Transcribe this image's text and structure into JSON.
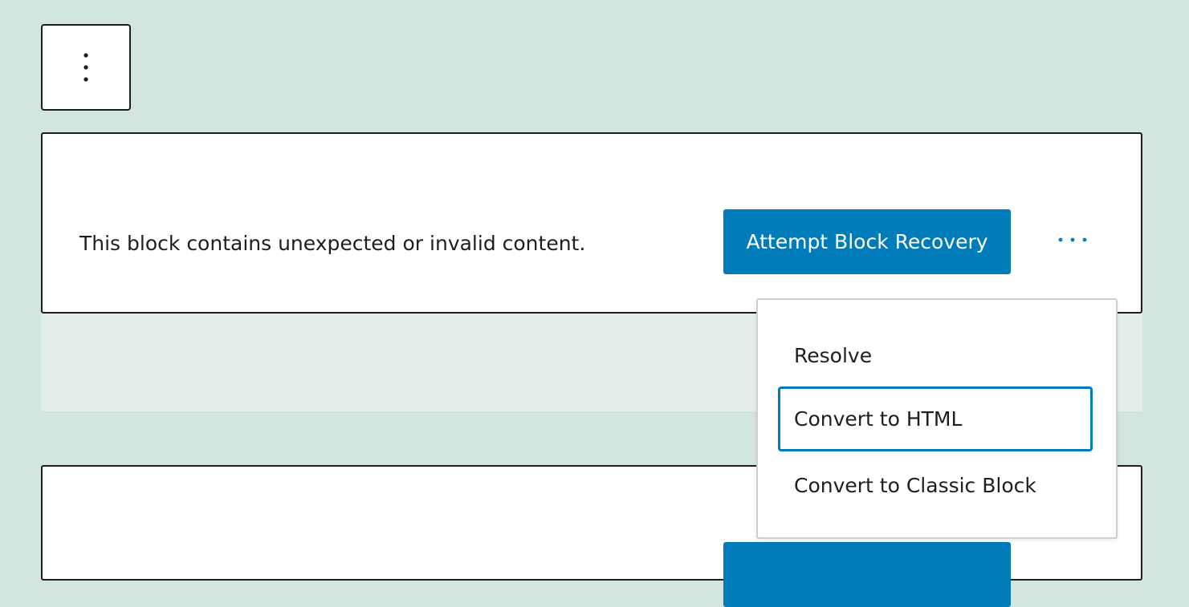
{
  "block_toolbar": {
    "options_icon": "vertical-ellipsis-icon"
  },
  "warning_block": {
    "message": "This block contains unexpected or invalid content.",
    "recovery_button_label": "Attempt Block Recovery",
    "more_icon": "horizontal-ellipsis-icon"
  },
  "second_block": {
    "recovery_button_label": ""
  },
  "dropdown_menu": {
    "items": [
      {
        "label": "Resolve",
        "focused": false
      },
      {
        "label": "Convert to HTML",
        "focused": true
      },
      {
        "label": "Convert to Classic Block",
        "focused": false
      }
    ]
  },
  "colors": {
    "canvas_background": "#d2e5df",
    "accent": "#007cba",
    "text": "#1e1e1e"
  }
}
